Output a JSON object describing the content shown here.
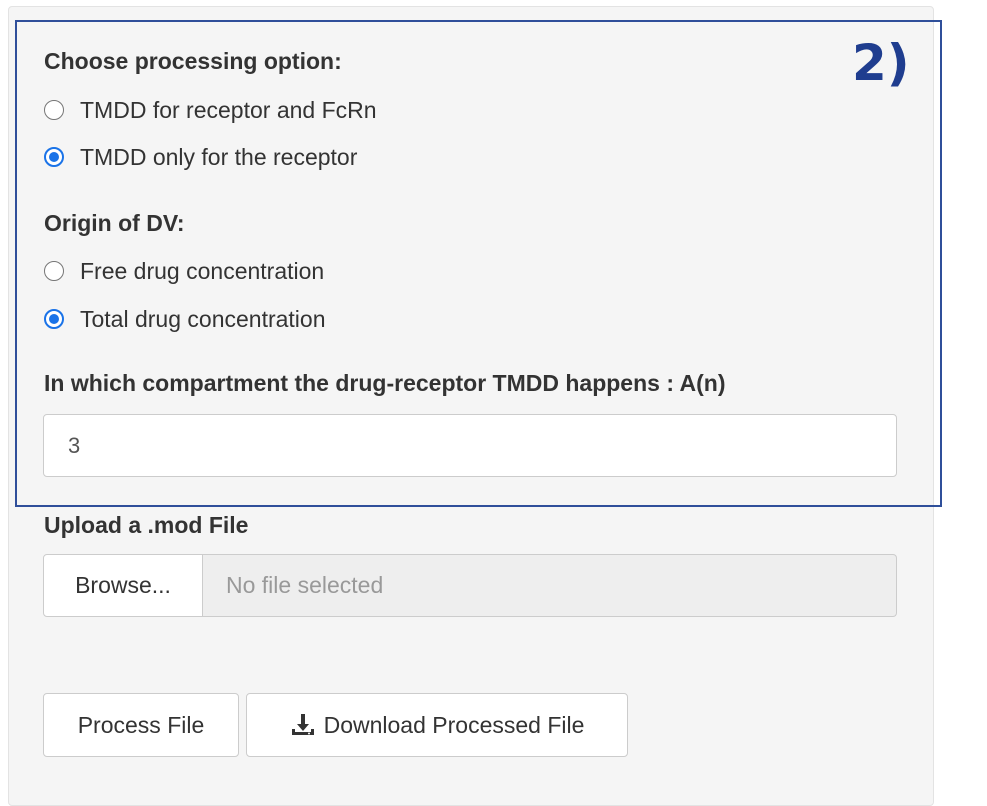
{
  "step_label": "2)",
  "processing": {
    "label": "Choose processing option:",
    "options": [
      {
        "label": "TMDD for receptor and FcRn",
        "checked": false
      },
      {
        "label": "TMDD only for the receptor",
        "checked": true
      }
    ]
  },
  "dv_origin": {
    "label": "Origin of DV:",
    "options": [
      {
        "label": "Free drug concentration",
        "checked": false
      },
      {
        "label": "Total drug concentration",
        "checked": true
      }
    ]
  },
  "compartment": {
    "label": "In which compartment the drug-receptor TMDD happens : A(n)",
    "value": "3"
  },
  "upload": {
    "label": "Upload a .mod File",
    "browse_label": "Browse...",
    "placeholder": "No file selected"
  },
  "actions": {
    "process_label": "Process File",
    "download_label": "Download Processed File",
    "download_icon": "download-icon"
  },
  "colors": {
    "accent": "#1a73e8",
    "highlight_border": "#2f4f9a",
    "step_label": "#1f3d8f"
  }
}
